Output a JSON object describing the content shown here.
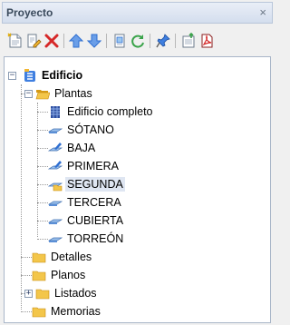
{
  "panel": {
    "title": "Proyecto",
    "close_glyph": "×"
  },
  "toolbar": {
    "buttons": [
      {
        "name": "new-document-icon"
      },
      {
        "name": "edit-document-icon"
      },
      {
        "name": "delete-icon"
      },
      {
        "name": "move-up-icon"
      },
      {
        "name": "move-down-icon"
      },
      {
        "name": "page-setup-icon"
      },
      {
        "name": "refresh-icon"
      },
      {
        "name": "pin-icon"
      },
      {
        "name": "import-icon"
      },
      {
        "name": "pdf-icon"
      }
    ]
  },
  "tree": {
    "root": {
      "label": "Edificio",
      "expander": "−"
    },
    "plantas": {
      "label": "Plantas",
      "expander": "−"
    },
    "floors": [
      {
        "label": "Edificio completo",
        "icon": "building-grid-icon"
      },
      {
        "label": "SÓTANO",
        "icon": "floor-slab-icon"
      },
      {
        "label": "BAJA",
        "icon": "floor-edit-icon"
      },
      {
        "label": "PRIMERA",
        "icon": "floor-edit-icon"
      },
      {
        "label": "SEGUNDA",
        "icon": "floor-folder-icon",
        "selected": true
      },
      {
        "label": "TERCERA",
        "icon": "floor-slab-icon"
      },
      {
        "label": "CUBIERTA",
        "icon": "floor-slab-icon"
      },
      {
        "label": "TORREÓN",
        "icon": "floor-slab-icon"
      }
    ],
    "folders": [
      {
        "label": "Detalles"
      },
      {
        "label": "Planos"
      },
      {
        "label": "Listados",
        "expander": "+"
      },
      {
        "label": "Memorias"
      }
    ]
  },
  "colors": {
    "folder": "#f3c64a",
    "folder_dark": "#d59a17",
    "accent_blue": "#2f6fd1",
    "delete_red": "#d62828"
  }
}
